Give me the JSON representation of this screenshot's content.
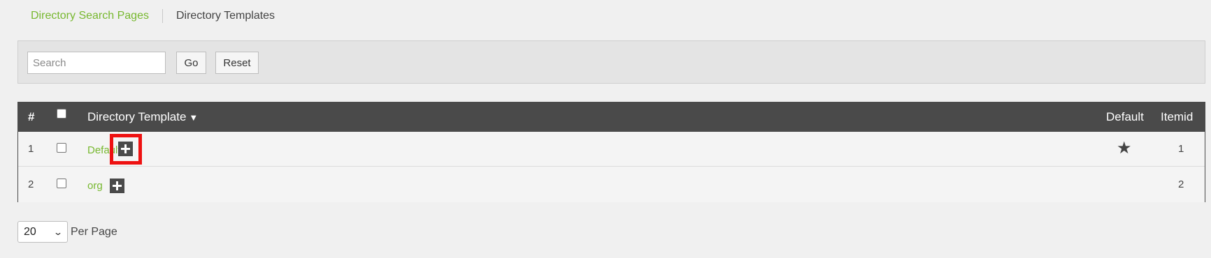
{
  "tabs": {
    "active_label": "Directory Search Pages",
    "second_label": "Directory Templates"
  },
  "search": {
    "placeholder": "Search",
    "value": "",
    "go_label": "Go",
    "reset_label": "Reset"
  },
  "table": {
    "columns": {
      "number": "#",
      "title": "Directory Template",
      "default": "Default",
      "itemid": "Itemid"
    },
    "sort_indicator": "▼",
    "rows": [
      {
        "number": "1",
        "title": "Default",
        "is_default": true,
        "itemid": "1"
      },
      {
        "number": "2",
        "title": "org",
        "is_default": false,
        "itemid": "2"
      }
    ]
  },
  "pagination": {
    "per_page_value": "20",
    "per_page_label": "Per Page"
  },
  "colors": {
    "accent": "#77b82f",
    "header_bg": "#4a4a4a",
    "highlight": "#ee1111"
  }
}
